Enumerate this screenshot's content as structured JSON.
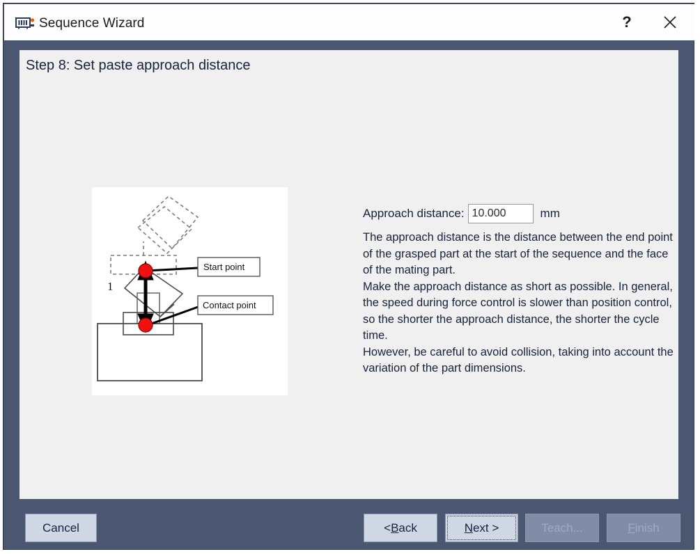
{
  "window": {
    "title": "Sequence Wizard",
    "icon": "device-module-icon",
    "help_label": "?",
    "close_label": "×"
  },
  "content": {
    "step_title": "Step 8: Set paste approach distance"
  },
  "field": {
    "label": "Approach distance:",
    "value": "10.000",
    "placeholder": "",
    "unit": "mm"
  },
  "description": {
    "paragraphs": [
      "The approach distance is the distance between the end point of the grasped part at the start of the sequence and the face of the mating part.",
      "Make the approach distance as short as possible. In general, the speed during force control is slower than position control, so the shorter the approach distance, the shorter the cycle time.",
      "However, be careful to avoid collision, taking into account the variation of the part dimensions."
    ]
  },
  "diagram": {
    "name": "paste-approach-distance-diagram",
    "labels": {
      "start_point": "Start point",
      "contact_point": "Contact point",
      "dimension": "1"
    },
    "colors": {
      "marker": "#ee1111",
      "outline": "#444444",
      "ghost": "#777777",
      "background": "#ffffff"
    }
  },
  "buttons": {
    "cancel": "Cancel",
    "back_prefix": "< ",
    "back_mnemonic": "B",
    "back_suffix": "ack",
    "next_mnemonic": "N",
    "next_suffix": "ext >",
    "teach": "Teach...",
    "finish_mnemonic": "F",
    "finish_suffix": "inish"
  },
  "theme": {
    "frame": "#4b5670",
    "panel": "#f0f0f0",
    "titlebar": "#fdfdfd",
    "text": "#16213c",
    "button_face": "#cfd6e4",
    "button_disabled": "#808ca8"
  }
}
